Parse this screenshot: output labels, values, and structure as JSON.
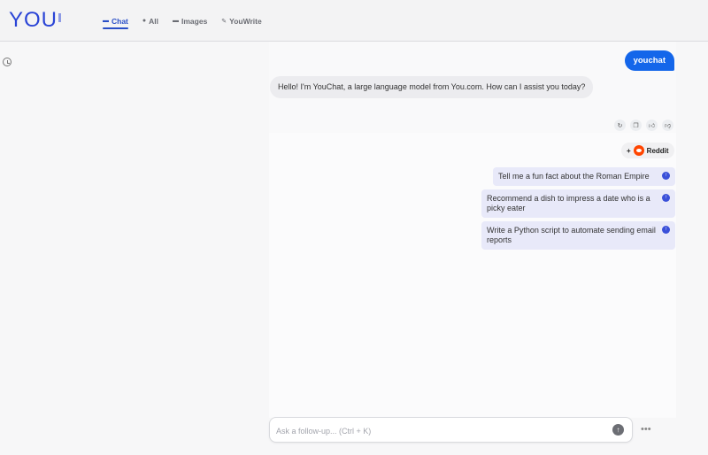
{
  "app": {
    "logo_text": "YOU"
  },
  "tabs": [
    {
      "label": "Chat",
      "icon": "chat-icon",
      "active": true
    },
    {
      "label": "All",
      "icon": "search-icon"
    },
    {
      "label": "Images",
      "icon": "image-icon"
    },
    {
      "label": "YouWrite",
      "icon": "pencil-icon"
    }
  ],
  "conversation": {
    "user_message": "youchat",
    "bot_message": "Hello! I'm YouChat, a large language model from You.com. How can I assist you today?"
  },
  "source": {
    "label": "Reddit",
    "prefix": "+"
  },
  "suggestions": [
    {
      "text": "Tell me a fun fact about the Roman Empire"
    },
    {
      "text": "Recommend a dish to impress a date who is a picky eater"
    },
    {
      "text": "Write a Python script to automate sending email reports"
    }
  ],
  "composer": {
    "placeholder": "Ask a follow-up... (Ctrl + K)"
  },
  "colors": {
    "brand": "#2a44d6",
    "user_bubble": "#1466ea",
    "suggestion_bg": "#e8e9f9",
    "reddit": "#ff4500"
  }
}
